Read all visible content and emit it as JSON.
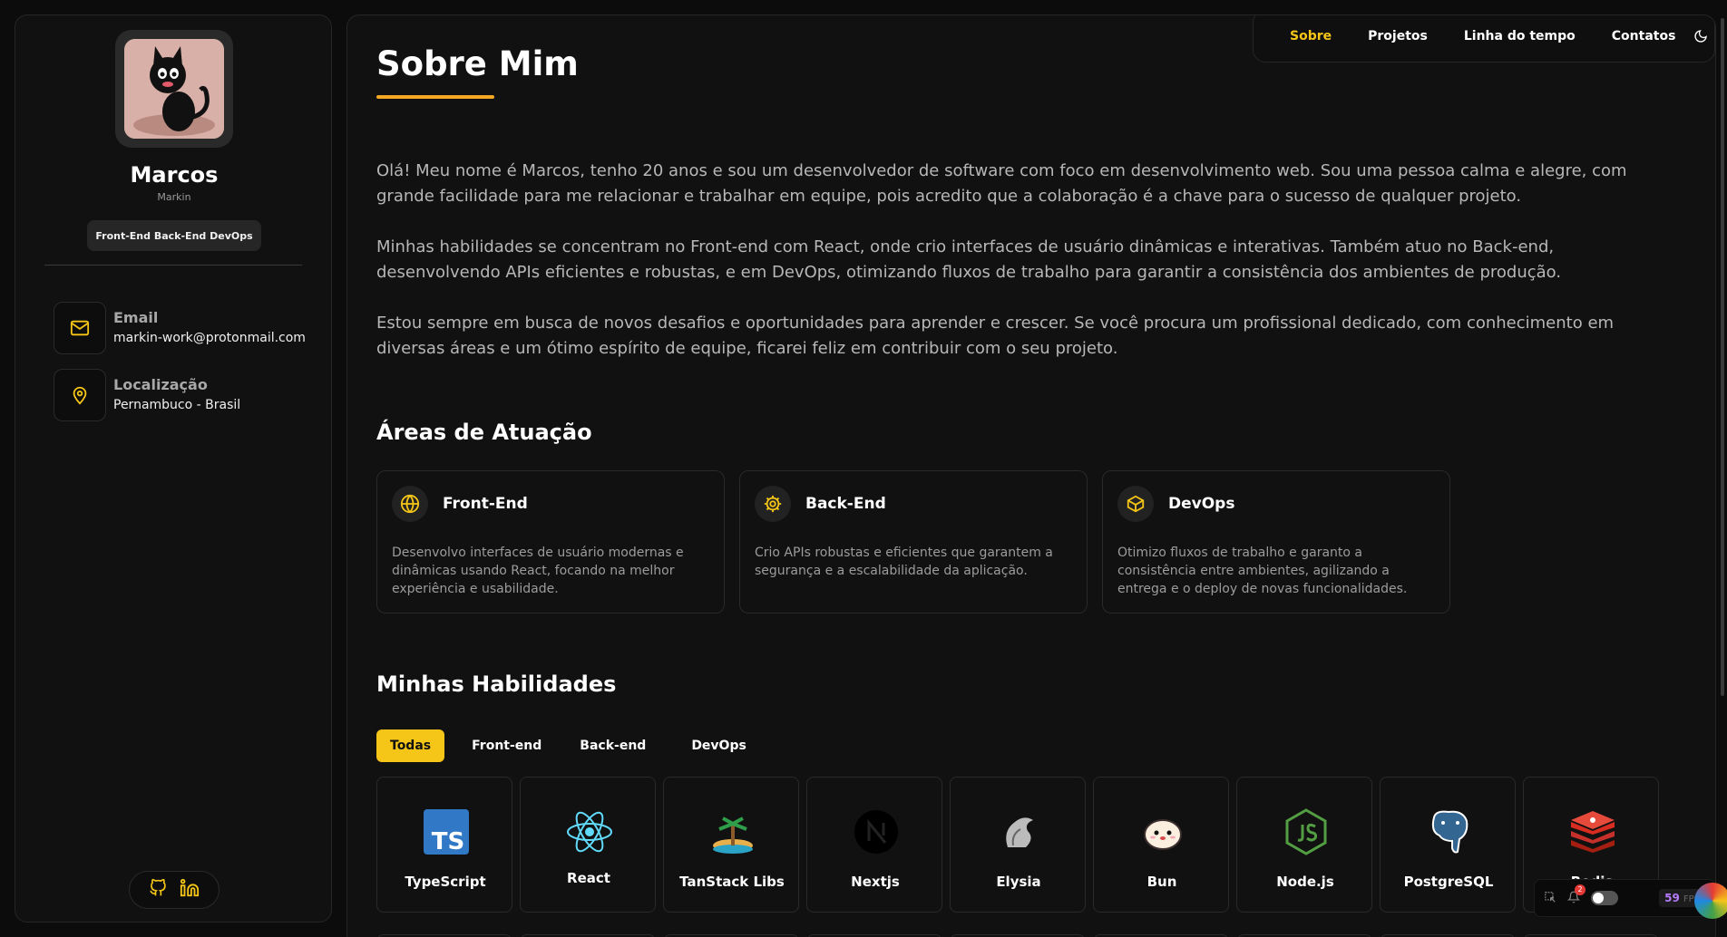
{
  "profile": {
    "name": "Marcos",
    "nickname": "Markin",
    "roles": "Front-End Back-End DevOps"
  },
  "contacts": [
    {
      "label": "Email",
      "value": "markin-work@protonmail.com",
      "icon": "mail-icon"
    },
    {
      "label": "Localização",
      "value": "Pernambuco - Brasil",
      "icon": "map-pin-icon"
    }
  ],
  "nav": {
    "items": [
      "Sobre",
      "Projetos",
      "Linha do tempo",
      "Contatos"
    ],
    "active": "Sobre"
  },
  "about": {
    "title": "Sobre Mim",
    "paragraphs": [
      "Olá! Meu nome é Marcos, tenho 20 anos e sou um desenvolvedor de software com foco em desenvolvimento web. Sou uma pessoa calma e alegre, com grande facilidade para me relacionar e trabalhar em equipe, pois acredito que a colaboração é a chave para o sucesso de qualquer projeto.",
      "Minhas habilidades se concentram no Front-end com React, onde crio interfaces de usuário dinâmicas e interativas. Também atuo no Back-end, desenvolvendo APIs eficientes e robustas, e em DevOps, otimizando fluxos de trabalho para garantir a consistência dos ambientes de produção.",
      "Estou sempre em busca de novos desafios e oportunidades para aprender e crescer. Se você procura um profissional dedicado, com conhecimento em diversas áreas e um ótimo espírito de equipe, ficarei feliz em contribuir com o seu projeto."
    ]
  },
  "areas": {
    "title": "Áreas de Atuação",
    "cards": [
      {
        "title": "Front-End",
        "desc": "Desenvolvo interfaces de usuário modernas e dinâmicas usando React, focando na melhor experiência e usabilidade.",
        "icon": "globe-icon"
      },
      {
        "title": "Back-End",
        "desc": "Crio APIs robustas e eficientes que garantem a segurança e a escalabilidade da aplicação.",
        "icon": "cog-icon"
      },
      {
        "title": "DevOps",
        "desc": "Otimizo fluxos de trabalho e garanto a consistência entre ambientes, agilizando a entrega e o deploy de novas funcionalidades.",
        "icon": "package-icon"
      }
    ]
  },
  "skills": {
    "title": "Minhas Habilidades",
    "filters": [
      "Todas",
      "Front-end",
      "Back-end",
      "DevOps"
    ],
    "active_filter": "Todas",
    "items": [
      "TypeScript",
      "React",
      "TanStack Libs",
      "Nextjs",
      "Elysia",
      "Bun",
      "Node.js",
      "PostgreSQL",
      "Redis"
    ]
  },
  "devtools": {
    "fps": "59",
    "fps_label": "FPS",
    "notifications": "2"
  },
  "colors": {
    "accent": "#f5c518",
    "background": "#0c0c0c",
    "panel": "#111111"
  }
}
